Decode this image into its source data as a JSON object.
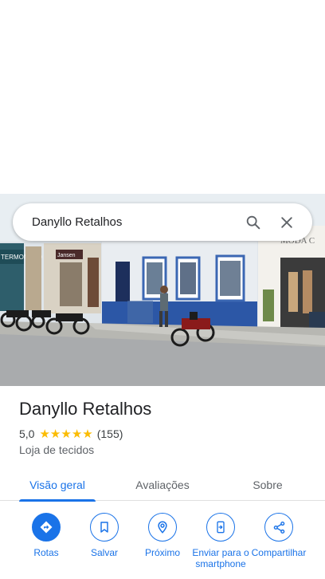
{
  "search": {
    "query": "Danyllo Retalhos"
  },
  "photo": {
    "signs": [
      "TERMONANO",
      "Jansen",
      "MODA C"
    ]
  },
  "place": {
    "title": "Danyllo Retalhos",
    "rating": "5,0",
    "stars": 5,
    "reviews": "(155)",
    "category": "Loja de tecidos"
  },
  "tabs": [
    {
      "label": "Visão geral",
      "active": true
    },
    {
      "label": "Avaliações",
      "active": false
    },
    {
      "label": "Sobre",
      "active": false
    }
  ],
  "actions": [
    {
      "label": "Rotas",
      "icon": "directions-icon"
    },
    {
      "label": "Salvar",
      "icon": "bookmark-icon"
    },
    {
      "label": "Próximo",
      "icon": "nearby-icon"
    },
    {
      "label": "Enviar para o smartphone",
      "icon": "send-to-phone-icon"
    },
    {
      "label": "Compartilhar",
      "icon": "share-icon"
    }
  ],
  "colors": {
    "accent": "#1a73e8",
    "star": "#fbbc04"
  }
}
